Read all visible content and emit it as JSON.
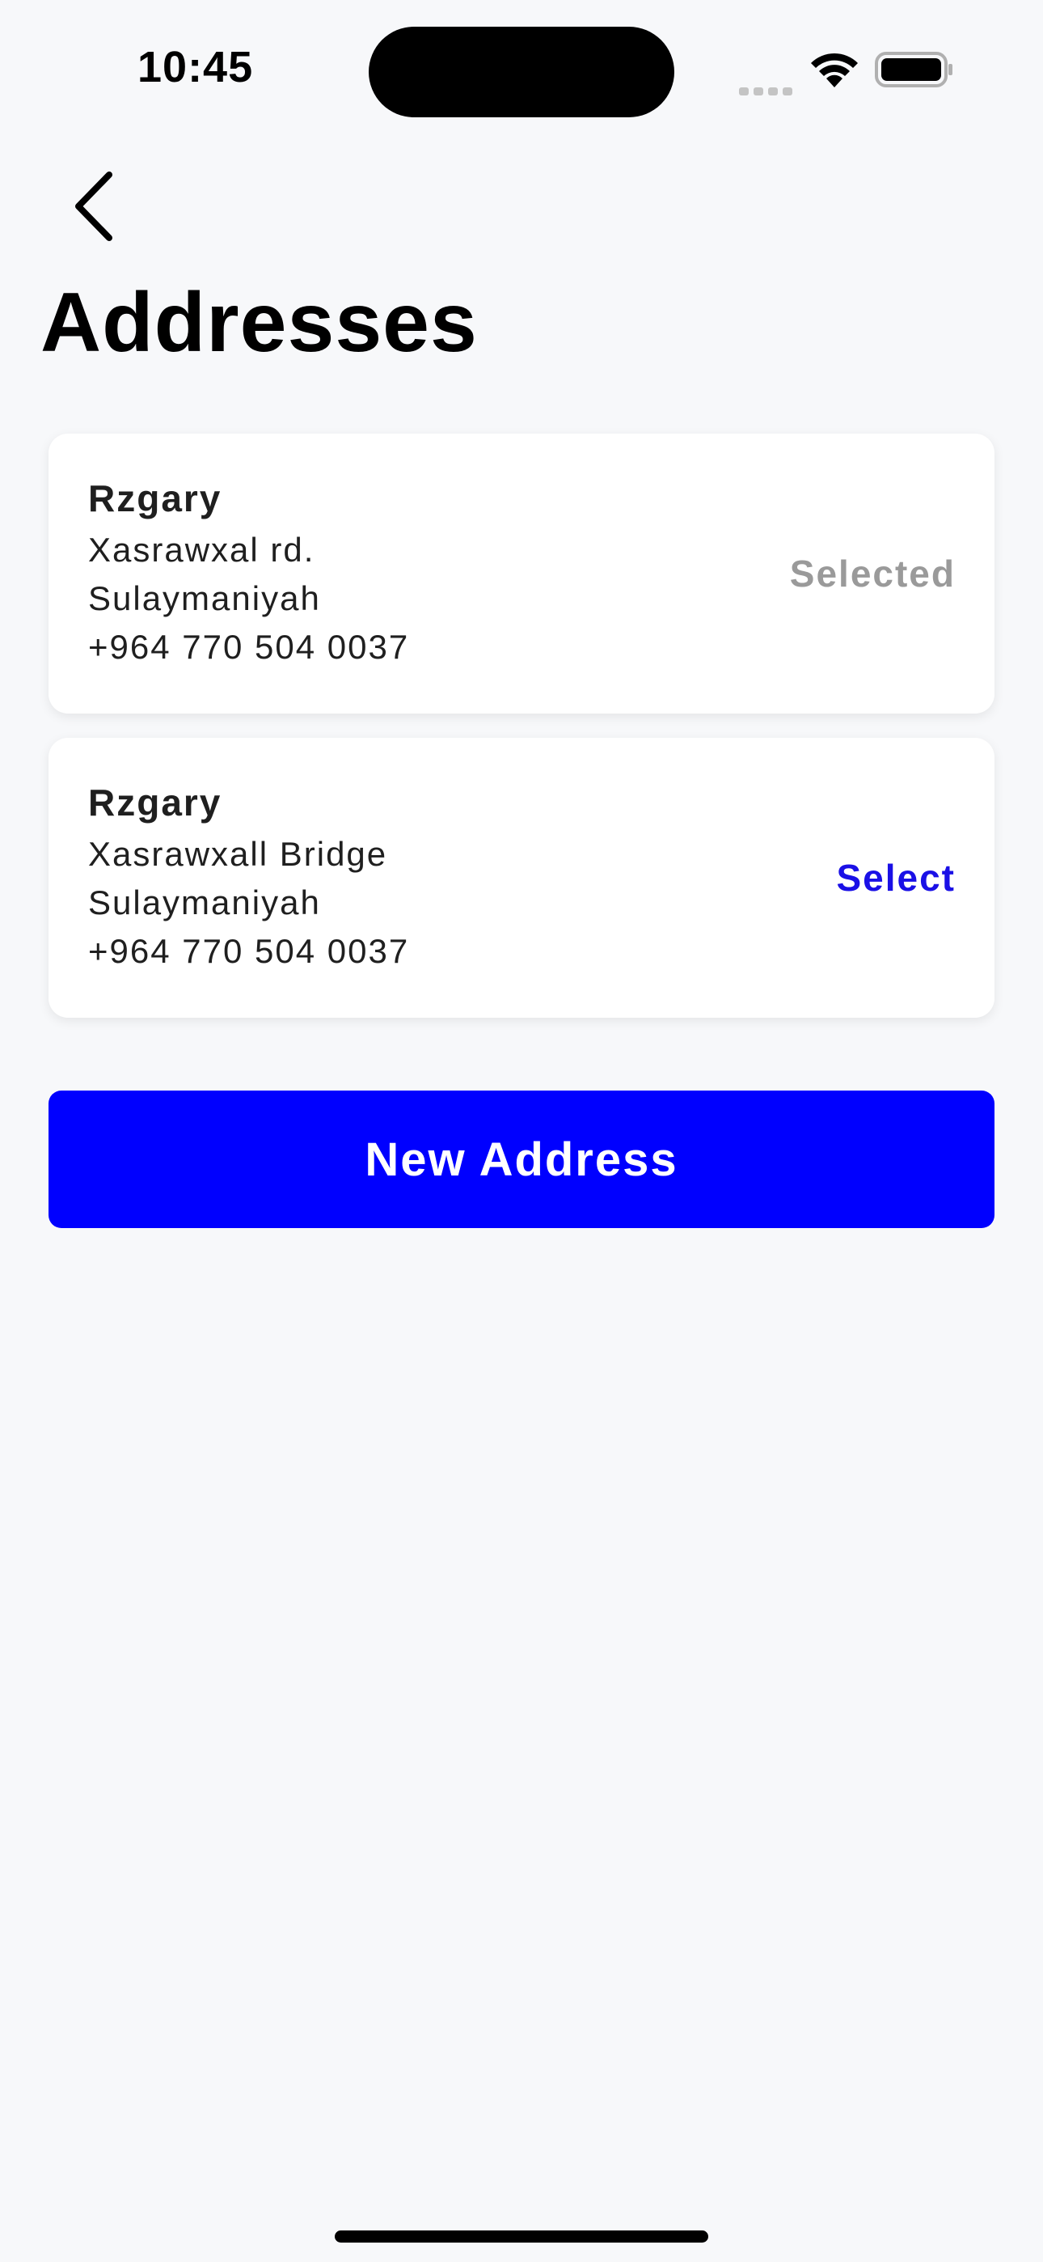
{
  "status_bar": {
    "time": "10:45",
    "icons": [
      "cellular-signal-icon",
      "wifi-icon",
      "battery-icon"
    ]
  },
  "nav": {
    "back_icon": "chevron-left-icon",
    "title": "Addresses"
  },
  "addresses": [
    {
      "name": "Rzgary",
      "street": "Xasrawxal rd.",
      "city": "Sulaymaniyah",
      "phone": "+964 770 504 0037",
      "action": "Selected",
      "selected": true
    },
    {
      "name": "Rzgary",
      "street": "Xasrawxall Bridge",
      "city": "Sulaymaniyah",
      "phone": "+964 770 504 0037",
      "action": "Select",
      "selected": false
    }
  ],
  "new_address_button": {
    "label": "New Address"
  },
  "colors": {
    "background": "#f7f8fa",
    "accent": "#0000ff",
    "select_link": "#1a10e6",
    "selected_text": "#9a9a9a",
    "card": "#ffffff"
  }
}
